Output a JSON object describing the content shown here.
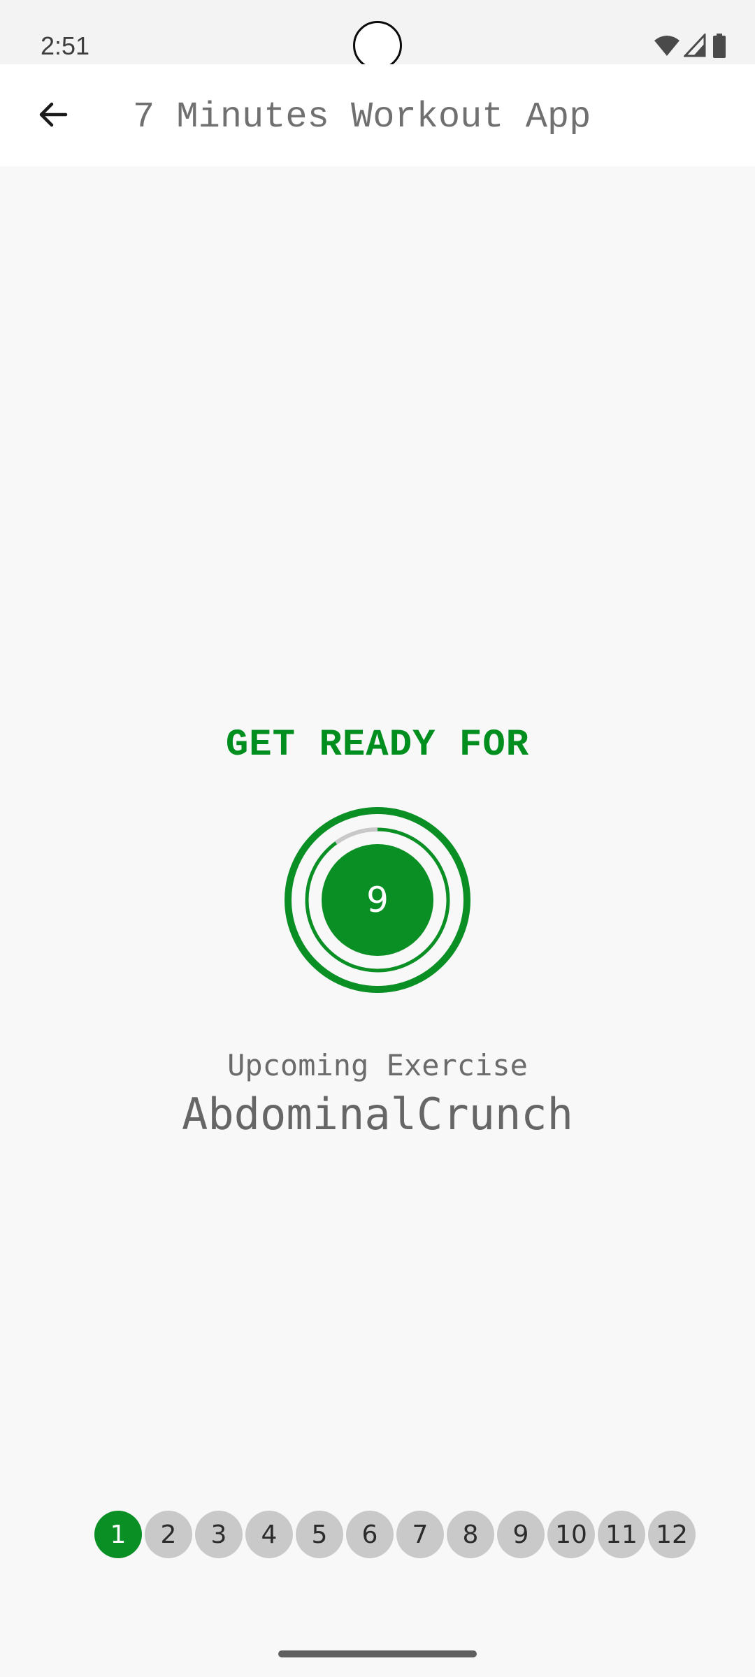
{
  "status_bar": {
    "time": "2:51",
    "icons": [
      "wifi-icon",
      "cell-signal-icon",
      "battery-icon"
    ]
  },
  "app_bar": {
    "back_icon": "arrow-left-icon",
    "title": "7 Minutes Workout App"
  },
  "main": {
    "heading": "GET READY FOR",
    "timer_value": "9",
    "timer_progress": 0.1,
    "upcoming_label": "Upcoming Exercise",
    "exercise_name": "AbdominalCrunch"
  },
  "progress": {
    "current": 1,
    "steps": [
      "1",
      "2",
      "3",
      "4",
      "5",
      "6",
      "7",
      "8",
      "9",
      "10",
      "11",
      "12"
    ]
  },
  "colors": {
    "accent": "#0a8f25",
    "inactive_step": "#c9c9c9",
    "background": "#f8f8f8"
  }
}
